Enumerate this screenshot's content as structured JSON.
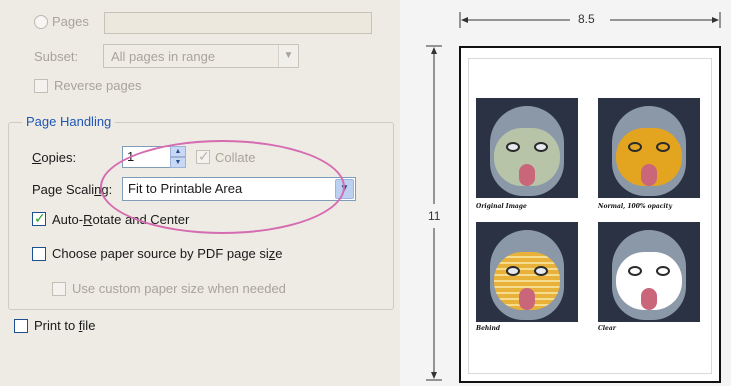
{
  "print_range": {
    "pages_label": "Pages",
    "pages_value": "",
    "subset_label": "Subset:",
    "subset_value": "All pages in range",
    "reverse_label": "Reverse pages"
  },
  "page_handling": {
    "legend": "Page Handling",
    "copies_label_u": "C",
    "copies_label_rest": "opies:",
    "copies_value": "1",
    "collate_label": "Collate",
    "scaling_label_pre": "Page Scali",
    "scaling_label_u": "n",
    "scaling_label_post": "g:",
    "scaling_value": "Fit to Printable Area",
    "auto_rotate_pre": "Auto-",
    "auto_rotate_u": "R",
    "auto_rotate_post": "otate and Center",
    "auto_rotate_checked": true,
    "paper_source_pre": "Choose paper source by PDF page si",
    "paper_source_u": "z",
    "paper_source_post": "e",
    "custom_paper_label": "Use custom paper size when needed"
  },
  "print_to_file": {
    "label_pre": "Print to ",
    "label_u": "f",
    "label_post": "ile"
  },
  "preview": {
    "width_label": "8.5",
    "height_label": "11",
    "captions": [
      "Original Image",
      "Normal, 100% opacity",
      "Behind",
      "Clear"
    ]
  },
  "colors": {
    "accent_blue": "#1f56b5",
    "highlight_pink": "#d56bb0",
    "check_green": "#21a121",
    "panel_bg": "#eeebe4"
  }
}
